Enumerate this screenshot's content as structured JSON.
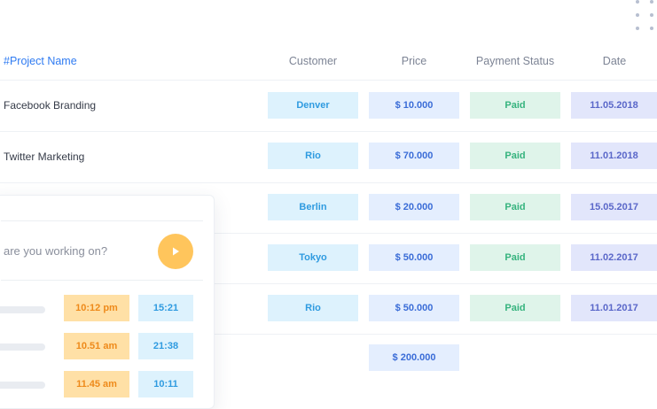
{
  "table": {
    "headers": {
      "project": "#Project Name",
      "customer": "Customer",
      "price": "Price",
      "payment_status": "Payment Status",
      "date": "Date"
    },
    "rows": [
      {
        "project": "Facebook Branding",
        "customer": "Denver",
        "price": "$ 10.000",
        "status": "Paid",
        "date": "11.05.2018"
      },
      {
        "project": "Twitter Marketing",
        "customer": "Rio",
        "price": "$ 70.000",
        "status": "Paid",
        "date": "11.01.2018"
      },
      {
        "project": "",
        "customer": "Berlin",
        "price": "$ 20.000",
        "status": "Paid",
        "date": "15.05.2017"
      },
      {
        "project": "",
        "customer": "Tokyo",
        "price": "$ 50.000",
        "status": "Paid",
        "date": "11.02.2017"
      },
      {
        "project": "",
        "customer": "Rio",
        "price": "$ 50.000",
        "status": "Paid",
        "date": "11.01.2017"
      }
    ],
    "total": "$ 200.000"
  },
  "timer": {
    "input_text": "are you working on?",
    "entries": [
      {
        "start": "10:12 pm",
        "duration": "15:21"
      },
      {
        "start": "10.51 am",
        "duration": "21:38"
      },
      {
        "start": "11.45 am",
        "duration": "10:11"
      }
    ]
  },
  "colors": {
    "accent_blue": "#2f7bf2",
    "paid_green": "#36b37e",
    "timer_orange": "#ffc55c"
  },
  "icons": {
    "menu": "more-dots-icon",
    "play": "play-icon"
  }
}
